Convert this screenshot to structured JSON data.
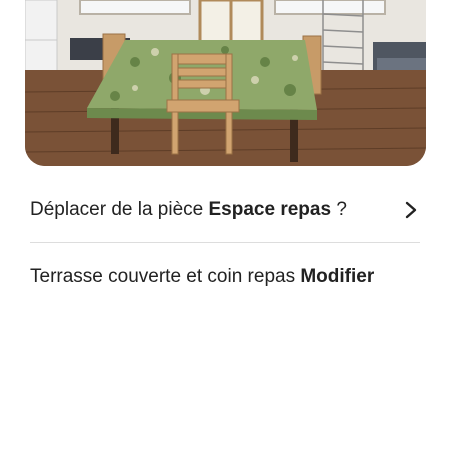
{
  "photo": {
    "subject": "dining-room-photo"
  },
  "move_row": {
    "prefix": "Déplacer de la pièce",
    "room_name": "Espace repas",
    "suffix": "?",
    "icon": "chevron-right-icon"
  },
  "room_row": {
    "label": "Terrasse couverte et coin repas",
    "edit_label": "Modifier"
  },
  "colors": {
    "text": "#222222",
    "divider": "#dddddd"
  }
}
